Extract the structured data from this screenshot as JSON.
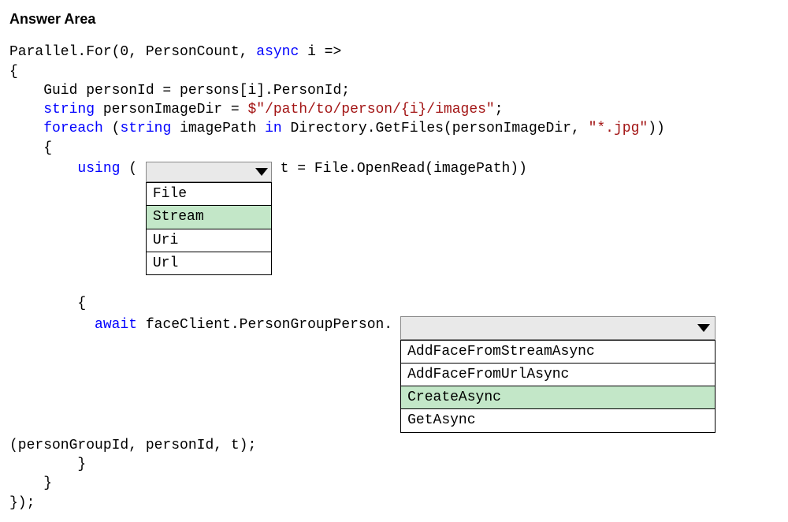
{
  "title": "Answer Area",
  "code": {
    "line1_a": "Parallel.For(0, PersonCount, ",
    "line1_b": "async",
    "line1_c": " i =>",
    "line2": "{",
    "line3": "    Guid personId = persons[i].PersonId;",
    "line4_a": "    ",
    "line4_b": "string",
    "line4_c": " personImageDir = ",
    "line4_d": "$\"/path/to/person/{i}/images\"",
    "line4_e": ";",
    "line5_a": "    ",
    "line5_b": "foreach",
    "line5_c": " (",
    "line5_d": "string",
    "line5_e": " imagePath ",
    "line5_f": "in",
    "line5_g": " Directory.GetFiles(personImageDir, ",
    "line5_h": "\"*.jpg\"",
    "line5_i": "))",
    "line6": "    {",
    "line7_a": "        ",
    "line7_b": "using",
    "line7_c": " ( ",
    "line7_d": " t = File.OpenRead(imagePath))",
    "line8": "        {",
    "line9_a": "          ",
    "line9_b": "await",
    "line9_c": " faceClient.PersonGroupPerson.",
    "line10": "(personGroupId, personId, t);",
    "line11": "        }",
    "line12": "    }",
    "line13": "});"
  },
  "dropdown1": {
    "selected": "",
    "options": [
      "File",
      "Stream",
      "Uri",
      "Url"
    ],
    "highlighted_index": 1
  },
  "dropdown2": {
    "selected": "",
    "options": [
      "AddFaceFromStreamAsync",
      "AddFaceFromUrlAsync",
      "CreateAsync",
      "GetAsync"
    ],
    "highlighted_index": 2
  }
}
